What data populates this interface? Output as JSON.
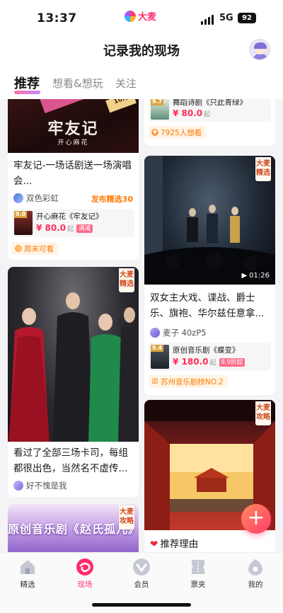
{
  "status_bar": {
    "time": "13:37",
    "brand": "大麦",
    "network": "5G",
    "battery": "92"
  },
  "header": {
    "title": "记录我的现场"
  },
  "tabs": [
    {
      "label": "推荐"
    },
    {
      "label": "想看&想玩"
    },
    {
      "label": "关注"
    }
  ],
  "feed": {
    "left": [
      {
        "image_text": {
          "main": "牢友记",
          "sub": "开心麻花",
          "corner": "10月"
        },
        "title": "牢友记-一场话剧送一场演唱会...",
        "user": "双色彩虹",
        "publish_tag": "发布精选30",
        "show": {
          "score": "9.0",
          "name": "开心麻花《牢友记》",
          "price": "¥ 80.0",
          "price_suffix": "起",
          "tag": "满减"
        },
        "chip": "周末可看"
      },
      {
        "badge": "大麦精选",
        "title": "看过了全部三场卡司，每组都很出色，当然名不虚传...",
        "user": "好不愧是我"
      },
      {
        "badge": "大麦攻略",
        "image_text": "原创音乐剧《赵氏孤儿》"
      }
    ],
    "right": [
      {
        "show": {
          "score": "9.7",
          "name": "舞蹈诗剧《只此青绿》",
          "price": "¥ 80.0",
          "price_suffix": "起"
        },
        "chip": "7925人想看"
      },
      {
        "badge": "大麦精选",
        "duration": "01:26",
        "title": "双女主大戏、谍战、爵士乐、旗袍、华尔兹任意拿...",
        "user": "麦子 40zP5",
        "show": {
          "score": "9.4",
          "name": "原创音乐剧《蝶变》",
          "price": "¥ 180.0",
          "price_suffix": "起",
          "tag": "8.9折起"
        },
        "chip": "苏州音乐剧榜NO.2"
      },
      {
        "badge": "大麦攻略",
        "title": "推荐理由"
      }
    ]
  },
  "fab": {
    "label": "+"
  },
  "bottom_nav": [
    {
      "label": "精选",
      "icon": "home-icon"
    },
    {
      "label": "现场",
      "icon": "scene-icon"
    },
    {
      "label": "会员",
      "icon": "member-icon"
    },
    {
      "label": "票夹",
      "icon": "ticket-icon"
    },
    {
      "label": "我的",
      "icon": "profile-icon"
    }
  ],
  "colors": {
    "accent": "#ff2d6a",
    "price": "#ff2d55",
    "orange": "#ff7a00"
  }
}
